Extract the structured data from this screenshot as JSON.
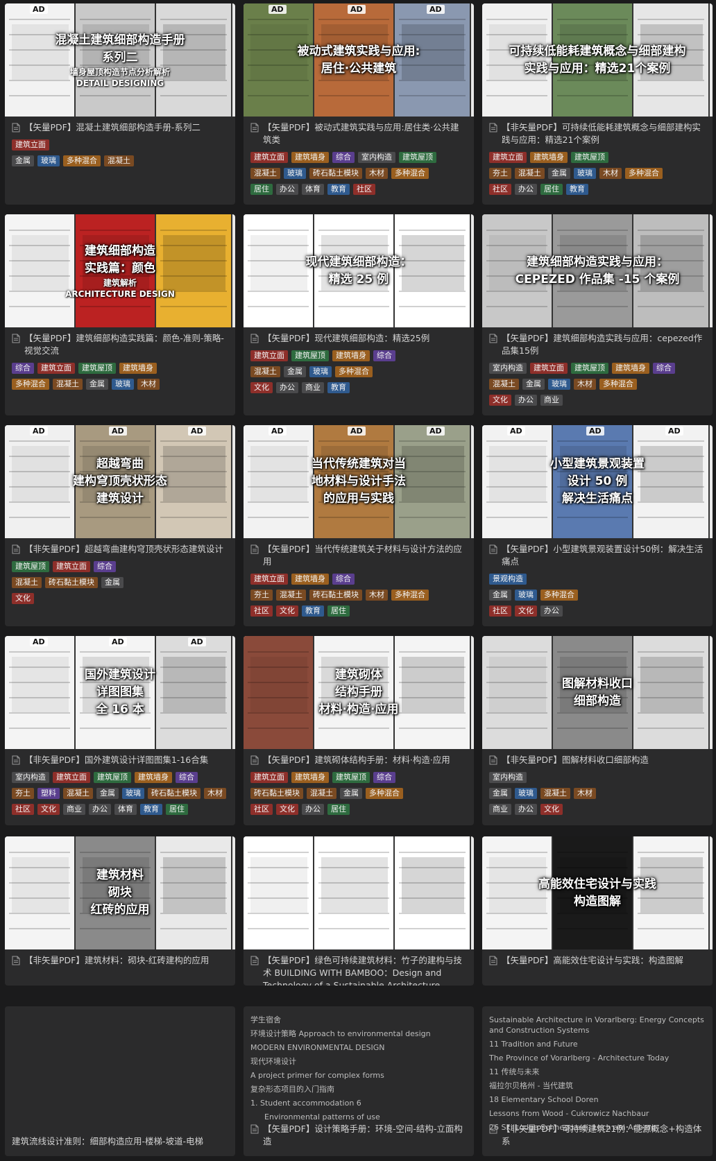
{
  "cards": [
    {
      "overlay": [
        "混凝土建筑细部构造手册",
        "系列二"
      ],
      "overlay_sub": [
        "墙身屋顶构造节点分析解析",
        "DETAIL DESIGNING"
      ],
      "ad_marks": [
        "AD"
      ],
      "title": "【矢量PDF】混凝土建筑细部构造手册-系列二",
      "tag_rows": [
        [
          {
            "t": "建筑立面",
            "c": "red"
          }
        ],
        [
          {
            "t": "金属",
            "c": "grey"
          },
          {
            "t": "玻璃",
            "c": "blue"
          },
          {
            "t": "多种混合",
            "c": "orange"
          },
          {
            "t": "混凝土",
            "c": "brown"
          }
        ]
      ]
    },
    {
      "overlay": [
        "被动式建筑实践与应用:",
        "居住·公共建筑"
      ],
      "overlay_sub": [],
      "ad_marks": [
        "AD",
        "AD",
        "AD"
      ],
      "title": "【矢量PDF】被动式建筑实践与应用:居住类·公共建筑类",
      "tag_rows": [
        [
          {
            "t": "建筑立面",
            "c": "red"
          },
          {
            "t": "建筑墙身",
            "c": "orange"
          },
          {
            "t": "综合",
            "c": "purple"
          },
          {
            "t": "室内构造",
            "c": "grey"
          },
          {
            "t": "建筑屋顶",
            "c": "green"
          }
        ],
        [
          {
            "t": "混凝土",
            "c": "brown"
          },
          {
            "t": "玻璃",
            "c": "blue"
          },
          {
            "t": "砖石黏土模块",
            "c": "brown"
          },
          {
            "t": "木材",
            "c": "brown"
          },
          {
            "t": "多种混合",
            "c": "orange"
          }
        ],
        [
          {
            "t": "居住",
            "c": "green"
          },
          {
            "t": "办公",
            "c": "grey"
          },
          {
            "t": "体育",
            "c": "grey"
          },
          {
            "t": "教育",
            "c": "blue"
          },
          {
            "t": "社区",
            "c": "red"
          }
        ]
      ]
    },
    {
      "overlay": [
        "可持续低能耗建筑概念与细部建构",
        "实践与应用：精选21个案例"
      ],
      "overlay_sub": [],
      "ad_marks": [],
      "title": "【非矢量PDF】可持续低能耗建筑概念与细部建构实践与应用：精选21个案例",
      "tag_rows": [
        [
          {
            "t": "建筑立面",
            "c": "red"
          },
          {
            "t": "建筑墙身",
            "c": "orange"
          },
          {
            "t": "建筑屋顶",
            "c": "green"
          }
        ],
        [
          {
            "t": "夯土",
            "c": "brown"
          },
          {
            "t": "混凝土",
            "c": "brown"
          },
          {
            "t": "金属",
            "c": "grey"
          },
          {
            "t": "玻璃",
            "c": "blue"
          },
          {
            "t": "木材",
            "c": "brown"
          },
          {
            "t": "多种混合",
            "c": "orange"
          }
        ],
        [
          {
            "t": "社区",
            "c": "red"
          },
          {
            "t": "办公",
            "c": "grey"
          },
          {
            "t": "居住",
            "c": "green"
          },
          {
            "t": "教育",
            "c": "blue"
          }
        ]
      ]
    },
    {
      "overlay": [
        "建筑细部构造",
        "实践篇：颜色"
      ],
      "overlay_sub": [
        "建筑解析",
        "ARCHITECTURE DESIGN"
      ],
      "ad_marks": [],
      "title": "【矢量PDF】建筑细部构造实践篇：颜色-准则-策略-视觉交流",
      "tag_rows": [
        [
          {
            "t": "综合",
            "c": "purple"
          },
          {
            "t": "建筑立面",
            "c": "red"
          },
          {
            "t": "建筑屋顶",
            "c": "green"
          },
          {
            "t": "建筑墙身",
            "c": "orange"
          }
        ],
        [
          {
            "t": "多种混合",
            "c": "orange"
          },
          {
            "t": "混凝土",
            "c": "brown"
          },
          {
            "t": "金属",
            "c": "grey"
          },
          {
            "t": "玻璃",
            "c": "blue"
          },
          {
            "t": "木材",
            "c": "brown"
          }
        ]
      ]
    },
    {
      "overlay": [
        "现代建筑细部构造：",
        "精选 25 例"
      ],
      "overlay_sub": [],
      "ad_marks": [],
      "title": "【矢量PDF】现代建筑细部构造：精选25例",
      "tag_rows": [
        [
          {
            "t": "建筑立面",
            "c": "red"
          },
          {
            "t": "建筑屋顶",
            "c": "green"
          },
          {
            "t": "建筑墙身",
            "c": "orange"
          },
          {
            "t": "综合",
            "c": "purple"
          }
        ],
        [
          {
            "t": "混凝土",
            "c": "brown"
          },
          {
            "t": "金属",
            "c": "grey"
          },
          {
            "t": "玻璃",
            "c": "blue"
          },
          {
            "t": "多种混合",
            "c": "orange"
          }
        ],
        [
          {
            "t": "文化",
            "c": "red"
          },
          {
            "t": "办公",
            "c": "grey"
          },
          {
            "t": "商业",
            "c": "grey"
          },
          {
            "t": "教育",
            "c": "blue"
          }
        ]
      ]
    },
    {
      "overlay": [
        "建筑细部构造实践与应用：",
        "CEPEZED 作品集 -15 个案例"
      ],
      "overlay_sub": [],
      "ad_marks": [],
      "title": "【矢量PDF】建筑细部构造实践与应用：cepezed作品集15例",
      "tag_rows": [
        [
          {
            "t": "室内构造",
            "c": "grey"
          },
          {
            "t": "建筑立面",
            "c": "red"
          },
          {
            "t": "建筑屋顶",
            "c": "green"
          },
          {
            "t": "建筑墙身",
            "c": "orange"
          },
          {
            "t": "综合",
            "c": "purple"
          }
        ],
        [
          {
            "t": "混凝土",
            "c": "brown"
          },
          {
            "t": "金属",
            "c": "grey"
          },
          {
            "t": "玻璃",
            "c": "blue"
          },
          {
            "t": "木材",
            "c": "brown"
          },
          {
            "t": "多种混合",
            "c": "orange"
          }
        ],
        [
          {
            "t": "文化",
            "c": "red"
          },
          {
            "t": "办公",
            "c": "grey"
          },
          {
            "t": "商业",
            "c": "grey"
          }
        ]
      ]
    },
    {
      "overlay": [
        "超越弯曲",
        "建构穹顶壳状形态",
        "建筑设计"
      ],
      "overlay_sub": [],
      "ad_marks": [
        "AD",
        "AD",
        "AD"
      ],
      "title": "【非矢量PDF】超越弯曲建构穹顶壳状形态建筑设计",
      "tag_rows": [
        [
          {
            "t": "建筑屋顶",
            "c": "green"
          },
          {
            "t": "建筑立面",
            "c": "red"
          },
          {
            "t": "综合",
            "c": "purple"
          }
        ],
        [
          {
            "t": "混凝土",
            "c": "brown"
          },
          {
            "t": "砖石黏土模块",
            "c": "brown"
          },
          {
            "t": "金属",
            "c": "grey"
          }
        ],
        [
          {
            "t": "文化",
            "c": "red"
          }
        ]
      ]
    },
    {
      "overlay": [
        "当代传统建筑对当",
        "地材料与设计手法",
        "的应用与实践"
      ],
      "overlay_sub": [],
      "ad_marks": [
        "AD",
        "AD",
        "AD"
      ],
      "title": "【矢量PDF】当代传统建筑关于材料与设计方法的应用",
      "tag_rows": [
        [
          {
            "t": "建筑立面",
            "c": "red"
          },
          {
            "t": "建筑墙身",
            "c": "orange"
          },
          {
            "t": "综合",
            "c": "purple"
          }
        ],
        [
          {
            "t": "夯土",
            "c": "brown"
          },
          {
            "t": "混凝土",
            "c": "brown"
          },
          {
            "t": "砖石黏土模块",
            "c": "brown"
          },
          {
            "t": "木材",
            "c": "brown"
          },
          {
            "t": "多种混合",
            "c": "orange"
          }
        ],
        [
          {
            "t": "社区",
            "c": "red"
          },
          {
            "t": "文化",
            "c": "red"
          },
          {
            "t": "教育",
            "c": "blue"
          },
          {
            "t": "居住",
            "c": "green"
          }
        ]
      ]
    },
    {
      "overlay": [
        "小型建筑景观装置",
        "设计 50 例",
        "解决生活痛点"
      ],
      "overlay_sub": [],
      "ad_marks": [
        "AD",
        "AD",
        "AD"
      ],
      "title": "【矢量PDF】小型建筑景观装置设计50例：解决生活痛点",
      "tag_rows": [
        [
          {
            "t": "景观构造",
            "c": "blue"
          }
        ],
        [
          {
            "t": "金属",
            "c": "grey"
          },
          {
            "t": "玻璃",
            "c": "blue"
          },
          {
            "t": "多种混合",
            "c": "orange"
          }
        ],
        [
          {
            "t": "社区",
            "c": "red"
          },
          {
            "t": "文化",
            "c": "red"
          },
          {
            "t": "办公",
            "c": "grey"
          }
        ]
      ]
    },
    {
      "overlay": [
        "国外建筑设计",
        "详图图集",
        "全 16 本"
      ],
      "overlay_sub": [],
      "ad_marks": [
        "AD",
        "AD",
        "AD"
      ],
      "title": "【非矢量PDF】国外建筑设计详图图集1-16合集",
      "tag_rows": [
        [
          {
            "t": "室内构造",
            "c": "grey"
          },
          {
            "t": "建筑立面",
            "c": "red"
          },
          {
            "t": "建筑屋顶",
            "c": "green"
          },
          {
            "t": "建筑墙身",
            "c": "orange"
          },
          {
            "t": "综合",
            "c": "purple"
          }
        ],
        [
          {
            "t": "夯土",
            "c": "brown"
          },
          {
            "t": "塑料",
            "c": "purple"
          },
          {
            "t": "混凝土",
            "c": "brown"
          },
          {
            "t": "金属",
            "c": "grey"
          },
          {
            "t": "玻璃",
            "c": "blue"
          },
          {
            "t": "砖石黏土模块",
            "c": "brown"
          },
          {
            "t": "木材",
            "c": "brown"
          }
        ],
        [
          {
            "t": "社区",
            "c": "red"
          },
          {
            "t": "文化",
            "c": "red"
          },
          {
            "t": "商业",
            "c": "grey"
          },
          {
            "t": "办公",
            "c": "grey"
          },
          {
            "t": "体育",
            "c": "grey"
          },
          {
            "t": "教育",
            "c": "blue"
          },
          {
            "t": "居住",
            "c": "green"
          }
        ]
      ]
    },
    {
      "overlay": [
        "建筑砌体",
        "结构手册",
        "材料·构造·应用"
      ],
      "overlay_sub": [],
      "ad_marks": [],
      "title": "【矢量PDF】建筑砌体结构手册：材料·构造·应用",
      "tag_rows": [
        [
          {
            "t": "建筑立面",
            "c": "red"
          },
          {
            "t": "建筑墙身",
            "c": "orange"
          },
          {
            "t": "建筑屋顶",
            "c": "green"
          },
          {
            "t": "综合",
            "c": "purple"
          }
        ],
        [
          {
            "t": "砖石黏土模块",
            "c": "brown"
          },
          {
            "t": "混凝土",
            "c": "brown"
          },
          {
            "t": "金属",
            "c": "grey"
          },
          {
            "t": "多种混合",
            "c": "orange"
          }
        ],
        [
          {
            "t": "社区",
            "c": "red"
          },
          {
            "t": "文化",
            "c": "red"
          },
          {
            "t": "办公",
            "c": "grey"
          },
          {
            "t": "居住",
            "c": "green"
          }
        ]
      ]
    },
    {
      "overlay": [
        "图解材料收口",
        "细部构造"
      ],
      "overlay_sub": [],
      "ad_marks": [],
      "title": "【非矢量PDF】图解材料收口细部构造",
      "tag_rows": [
        [
          {
            "t": "室内构造",
            "c": "grey"
          }
        ],
        [
          {
            "t": "金属",
            "c": "grey"
          },
          {
            "t": "玻璃",
            "c": "blue"
          },
          {
            "t": "混凝土",
            "c": "brown"
          },
          {
            "t": "木材",
            "c": "brown"
          }
        ],
        [
          {
            "t": "商业",
            "c": "grey"
          },
          {
            "t": "办公",
            "c": "grey"
          },
          {
            "t": "文化",
            "c": "red"
          }
        ]
      ]
    },
    {
      "overlay": [
        "建筑材料",
        "砌块",
        "红砖的应用"
      ],
      "overlay_sub": [],
      "ad_marks": [],
      "title": "【非矢量PDF】建筑材料：砌块-红砖建构的应用",
      "tag_rows": []
    },
    {
      "overlay": [],
      "overlay_sub": [],
      "ad_marks": [],
      "title": "【矢量PDF】绿色可持续建筑材料：竹子的建构与技术 BUILDING WITH BAMBOO：Design and Technology of a Sustainable Architecture",
      "tag_rows": []
    },
    {
      "overlay": [
        "高能效住宅设计与实践",
        "构造图解"
      ],
      "overlay_sub": [],
      "ad_marks": [],
      "title": "【矢量PDF】高能效住宅设计与实践：构造图解",
      "tag_rows": []
    }
  ],
  "text_cards": [
    {
      "lines": [],
      "title": "建筑流线设计准则：细部构造应用-楼梯-坡道-电梯",
      "has_icon": false
    },
    {
      "lines": [
        {
          "t": "学生宿舍",
          "sub": false
        },
        {
          "t": "环境设计策略 Approach to environmental design",
          "sub": false
        },
        {
          "t": "MODERN ENVIRONMENTAL DESIGN",
          "sub": false
        },
        {
          "t": "现代环境设计",
          "sub": false
        },
        {
          "t": "A project primer for complex forms",
          "sub": false
        },
        {
          "t": "复杂形态项目的入门指南",
          "sub": false
        },
        {
          "t": "1.    Student accommodation 6",
          "sub": false
        },
        {
          "t": "Environmental patterns of use",
          "sub": true
        }
      ],
      "title": "【矢量PDF】设计策略手册：环境-空间-结构-立面构造",
      "has_icon": true
    },
    {
      "lines": [
        {
          "t": "Sustainable Architecture in Vorarlberg: Energy Concepts and Construction Systems",
          "sub": false
        },
        {
          "t": "11 Tradition and Future",
          "sub": false
        },
        {
          "t": "The Province of Vorarlberg - Architecture Today",
          "sub": false
        },
        {
          "t": "11 传统与未来",
          "sub": false
        },
        {
          "t": "福拉尔贝格州 - 当代建筑",
          "sub": false
        },
        {
          "t": "18 Elementary School Doren",
          "sub": false
        },
        {
          "t": "Lessons from Wood - Cukrowicz Nachbaur",
          "sub": false
        },
        {
          "t": "26 Ski Lodge Schneggarei, Lech am Arlberg",
          "sub": false
        }
      ],
      "title": "【非矢量PDF】可持续建筑21例：能源概念+构造体系",
      "has_icon": true
    }
  ],
  "colors": {
    "background": "#1b1b1c",
    "card": "#2b2b2c",
    "tag_red": "#8e2f2a",
    "tag_orange": "#9a5f1f",
    "tag_green": "#2e6b3f",
    "tag_purple": "#5a3e8e",
    "tag_grey": "#4a4a4c",
    "tag_blue": "#2f5a8e",
    "tag_brown": "#7a4a22"
  }
}
